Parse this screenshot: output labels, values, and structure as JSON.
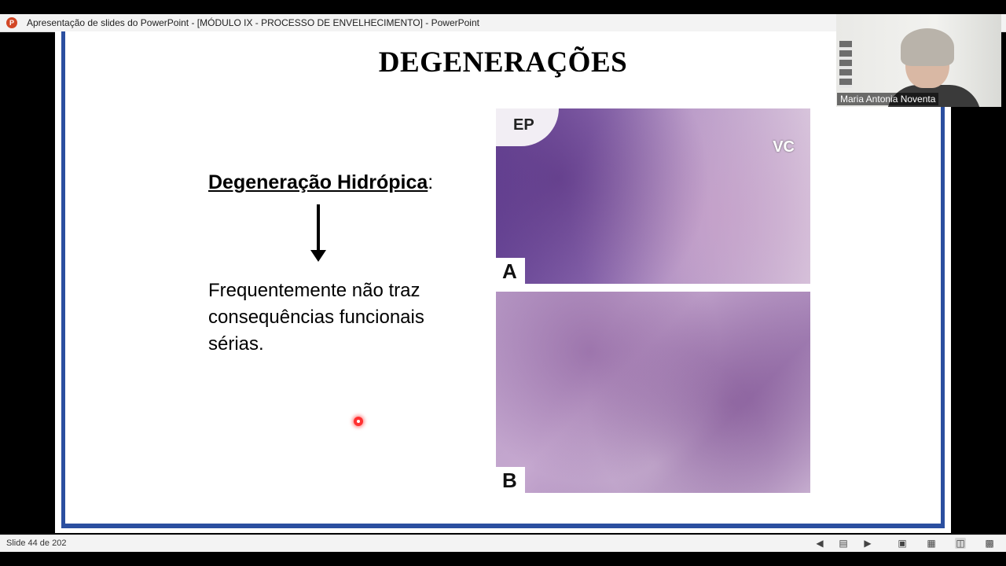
{
  "window": {
    "title": "Apresentação de slides do PowerPoint - [MÓDULO IX - PROCESSO DE ENVELHECIMENTO] - PowerPoint",
    "app_icon": "powerpoint-icon"
  },
  "slide": {
    "title": "DEGENERAÇÕES",
    "subheading": "Degeneração Hidrópica",
    "subheading_suffix": ":",
    "body": "Frequentemente não traz consequências funcionais sérias.",
    "figure": {
      "panel_a_label": "A",
      "panel_b_label": "B",
      "label_ep": "EP",
      "label_vc": "VC"
    },
    "accent_color": "#2b4fa0"
  },
  "video": {
    "participant_name": "Maria Antonia Noventa"
  },
  "statusbar": {
    "slide_counter": "Slide 44 de 202",
    "icons": [
      "previous-slide-icon",
      "slide-menu-icon",
      "next-slide-icon",
      "normal-view-icon",
      "slide-sorter-icon",
      "reading-view-icon",
      "slideshow-icon"
    ]
  }
}
